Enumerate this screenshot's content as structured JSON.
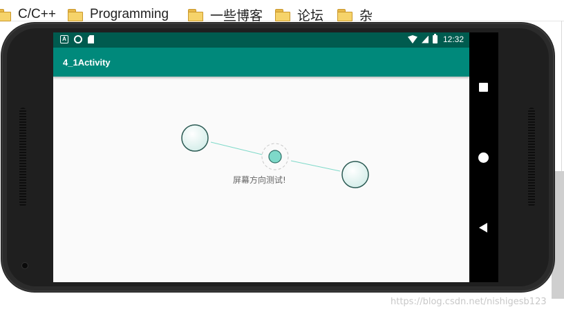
{
  "bookmarks": [
    {
      "label": "C/C++"
    },
    {
      "label": "Programming"
    },
    {
      "label": "一些博客"
    },
    {
      "label": "论坛"
    },
    {
      "label": "杂"
    }
  ],
  "statusbar": {
    "time": "12:32",
    "icons": [
      "a-icon",
      "ring-icon",
      "sd-card-icon",
      "wifi-icon",
      "cell-signal-icon",
      "battery-icon"
    ]
  },
  "appbar": {
    "title": "4_1Activity",
    "color": "#00897b",
    "status_color": "#005b4f"
  },
  "content": {
    "caption": "屏幕方向测试!",
    "accent": "#7ed9c9"
  },
  "navbar": {
    "buttons": [
      "recents-square-icon",
      "home-circle-icon",
      "back-triangle-icon"
    ]
  },
  "watermark": "https://blog.csdn.net/nishigesb123"
}
